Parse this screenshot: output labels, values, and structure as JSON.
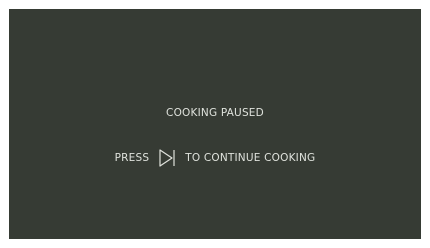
{
  "screen": {
    "status": "COOKING PAUSED",
    "instruction_prefix": "PRESS",
    "instruction_suffix": "TO CONTINUE COOKING",
    "icon": "play-pause-icon",
    "background_color": "#363b34",
    "text_color": "#dfe2dc"
  }
}
